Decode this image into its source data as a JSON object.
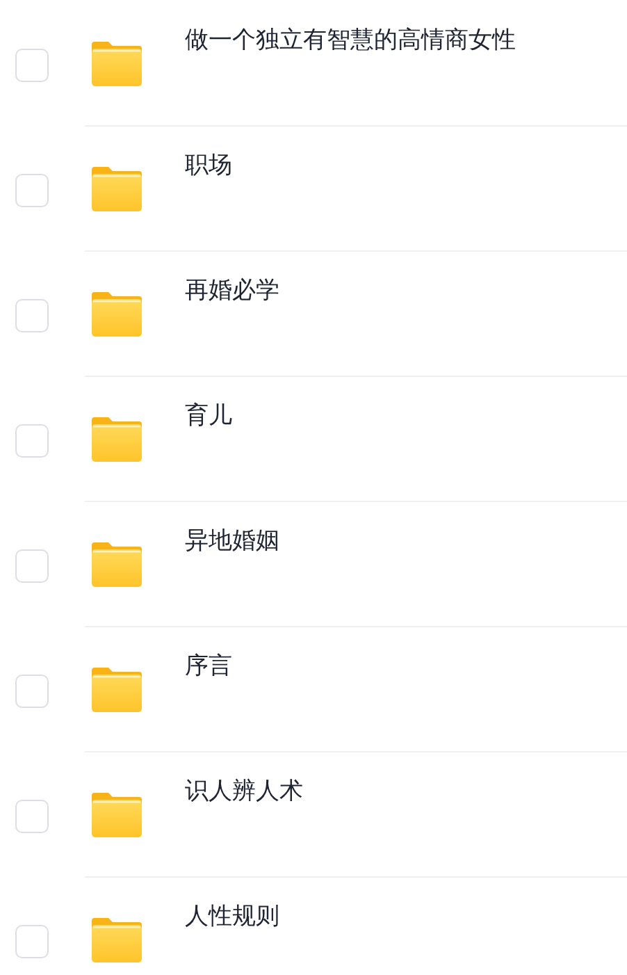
{
  "items": [
    {
      "name": "做一个独立有智慧的高情商女性",
      "checked": false
    },
    {
      "name": "职场",
      "checked": false
    },
    {
      "name": "再婚必学",
      "checked": false
    },
    {
      "name": "育儿",
      "checked": false
    },
    {
      "name": "异地婚姻",
      "checked": false
    },
    {
      "name": "序言",
      "checked": false
    },
    {
      "name": "识人辨人术",
      "checked": false
    },
    {
      "name": "人性规则",
      "checked": false
    }
  ]
}
